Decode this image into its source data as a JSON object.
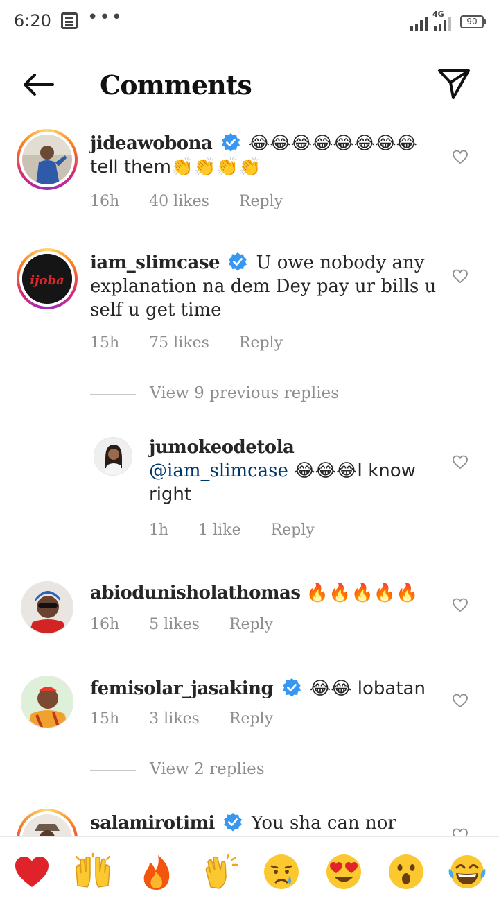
{
  "status_bar": {
    "time": "6:20",
    "network": "4G",
    "battery": "90"
  },
  "header": {
    "title": "Comments"
  },
  "comments": [
    {
      "username": "jideawobona",
      "verified": true,
      "text": "😂😂😂😂😂😂😂😂 tell them👏👏👏👏",
      "time": "16h",
      "likes": "40 likes",
      "reply": "Reply"
    },
    {
      "username": "iam_slimcase",
      "verified": true,
      "text": "U owe nobody any explanation na dem Dey pay ur bills u self u get time",
      "time": "15h",
      "likes": "75 likes",
      "reply": "Reply",
      "avatar_text": "ijoba"
    },
    {
      "username": "jumokeodetola",
      "verified": false,
      "mention": "@iam_slimcase",
      "text": "😂😂😂I know right",
      "time": "1h",
      "likes": "1 like",
      "reply": "Reply"
    },
    {
      "username": "abiodunisholathomas",
      "verified": false,
      "text": "🔥🔥🔥🔥🔥",
      "time": "16h",
      "likes": "5 likes",
      "reply": "Reply"
    },
    {
      "username": "femisolar_jasaking",
      "verified": true,
      "text": "😂😂 lobatan",
      "time": "15h",
      "likes": "3 likes",
      "reply": "Reply"
    },
    {
      "username": "salamirotimi",
      "verified": true,
      "text": "You sha can nor"
    }
  ],
  "view_replies": {
    "previous": "View 9 previous replies",
    "more": "View 2 replies"
  },
  "reaction_bar": {
    "emojis": [
      "❤️",
      "🙌",
      "🔥",
      "👏",
      "😢",
      "😍",
      "😮",
      "😂"
    ]
  },
  "colors": {
    "text": "#262626",
    "meta": "#8e8e8e",
    "verified": "#3897f0",
    "mention": "#00376b"
  }
}
